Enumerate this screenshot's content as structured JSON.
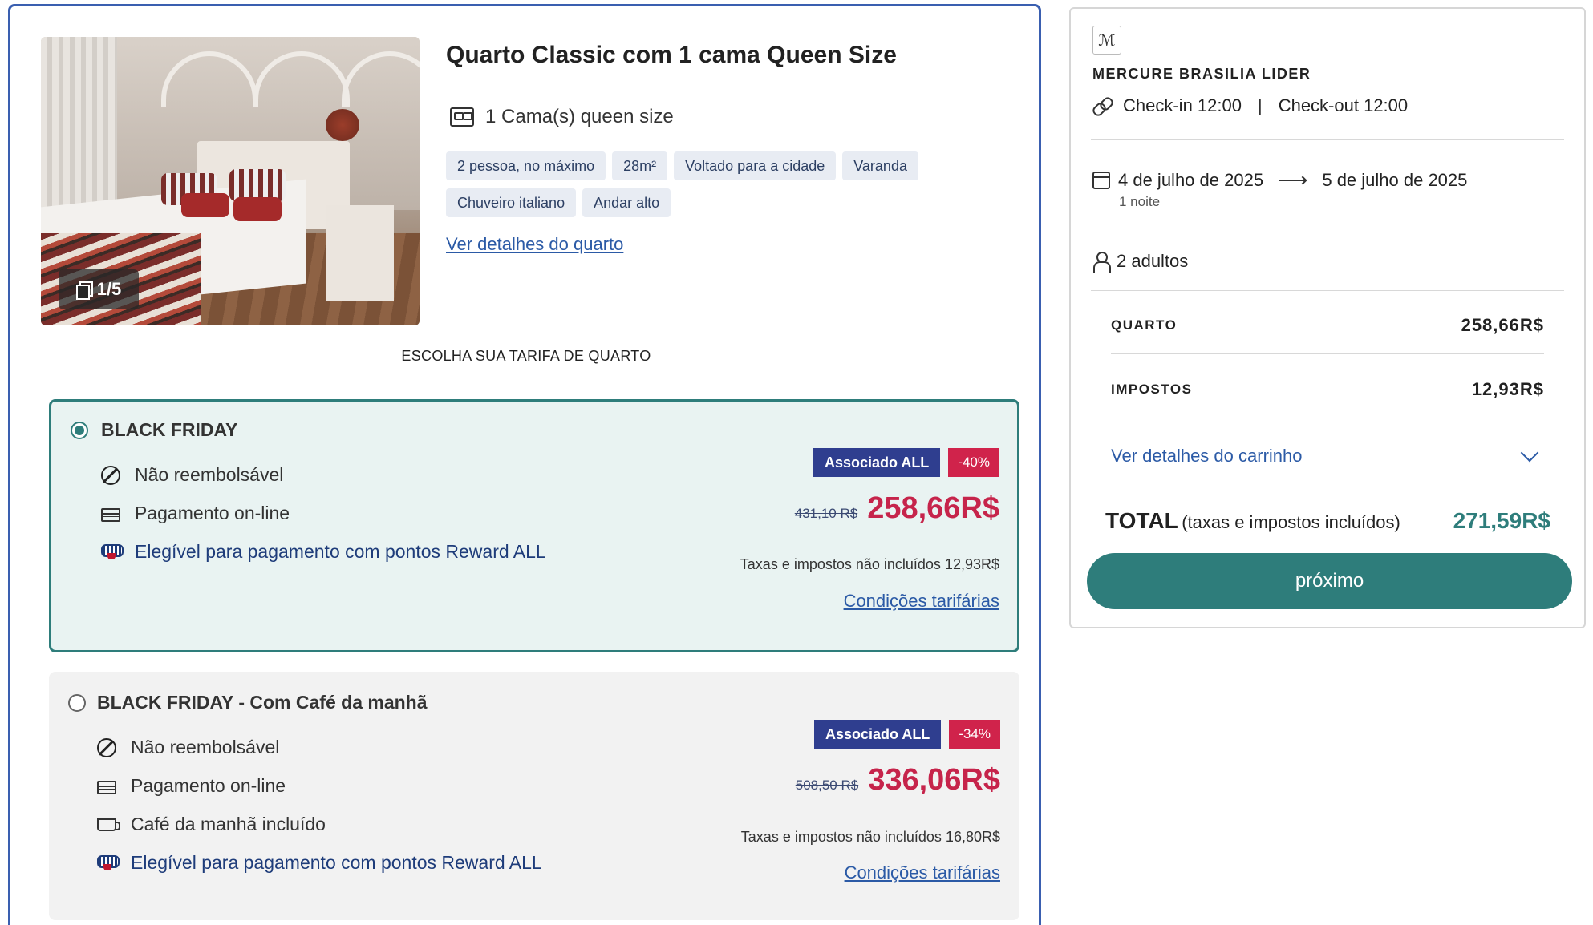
{
  "room": {
    "title": "Quarto Classic com 1 cama Queen Size",
    "bed": "1 Cama(s) queen size",
    "photo_counter": "1/5",
    "tags": [
      "2 pessoa, no máximo",
      "28m²",
      "Voltado para a cidade",
      "Varanda",
      "Chuveiro italiano",
      "Andar alto"
    ],
    "details_link": "Ver detalhes do quarto",
    "tariff_heading": "ESCOLHA SUA TARIFA DE QUARTO"
  },
  "rates": [
    {
      "title": "BLACK FRIDAY",
      "selected": true,
      "features": [
        "Não reembolsável",
        "Pagamento on-line",
        "Elegível para pagamento com pontos Reward ALL"
      ],
      "member_badge": "Associado ALL",
      "discount": "-40%",
      "old_price": "431,10 R$",
      "price": "258,66R$",
      "tax_note": "Taxas e impostos não incluídos 12,93R$",
      "conditions": "Condições tarifárias"
    },
    {
      "title": "BLACK FRIDAY - Com Café da manhã",
      "selected": false,
      "features": [
        "Não reembolsável",
        "Pagamento on-line",
        "Café da manhã incluído",
        "Elegível para pagamento com pontos Reward ALL"
      ],
      "member_badge": "Associado ALL",
      "discount": "-34%",
      "old_price": "508,50 R$",
      "price": "336,06R$",
      "tax_note": "Taxas e impostos não incluídos 16,80R$",
      "conditions": "Condições tarifárias"
    }
  ],
  "summary": {
    "hotel_name": "MERCURE BRASILIA LIDER",
    "checkin": "Check-in 12:00",
    "separator": "|",
    "checkout": "Check-out 12:00",
    "date_from": "4 de julho de 2025",
    "arrow": "⟶",
    "date_to": "5 de julho de 2025",
    "nights": "1 noite",
    "guests": "2 adultos",
    "room_label": "QUARTO",
    "room_value": "258,66R$",
    "tax_label": "IMPOSTOS",
    "tax_value": "12,93R$",
    "cart_link": "Ver detalhes do carrinho",
    "total_label": "TOTAL",
    "total_sub": "(taxas e impostos incluídos)",
    "total_value": "271,59R$",
    "next_button": "próximo"
  },
  "colors": {
    "primary": "#2e7d7b",
    "price_red": "#c6244b",
    "member_badge": "#2f3e8f",
    "card_border": "#3a5fb0"
  }
}
